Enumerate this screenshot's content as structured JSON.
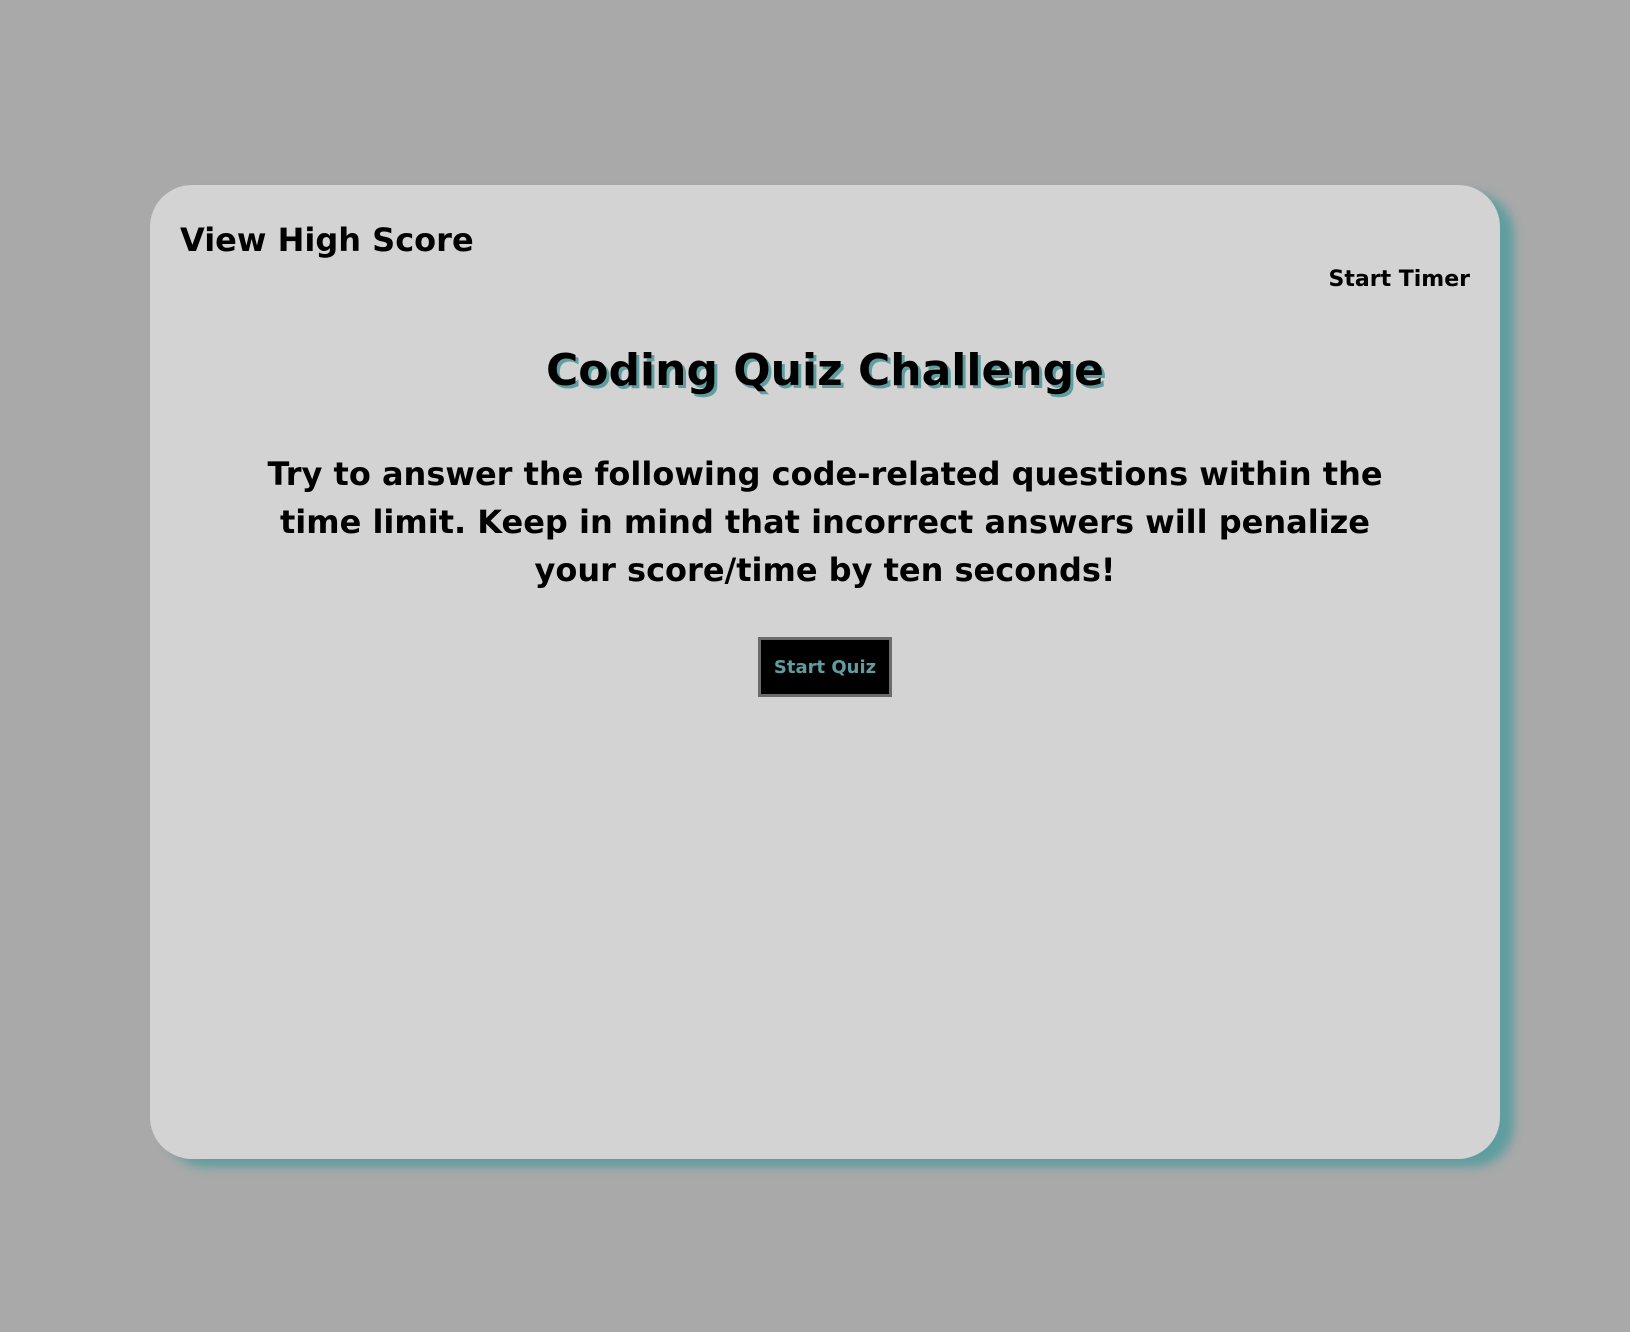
{
  "header": {
    "high_score_link": "View High Score",
    "timer_label": "Start Timer"
  },
  "main": {
    "title": "Coding Quiz Challenge",
    "intro": "Try to answer the following code-related questions within the time limit. Keep in mind that incorrect answers will penalize your score/time by ten seconds!",
    "start_button_label": "Start Quiz"
  },
  "colors": {
    "page_background": "#a9a9a9",
    "card_background": "#d3d3d3",
    "accent": "#5f9ea0",
    "button_background": "#000000"
  }
}
